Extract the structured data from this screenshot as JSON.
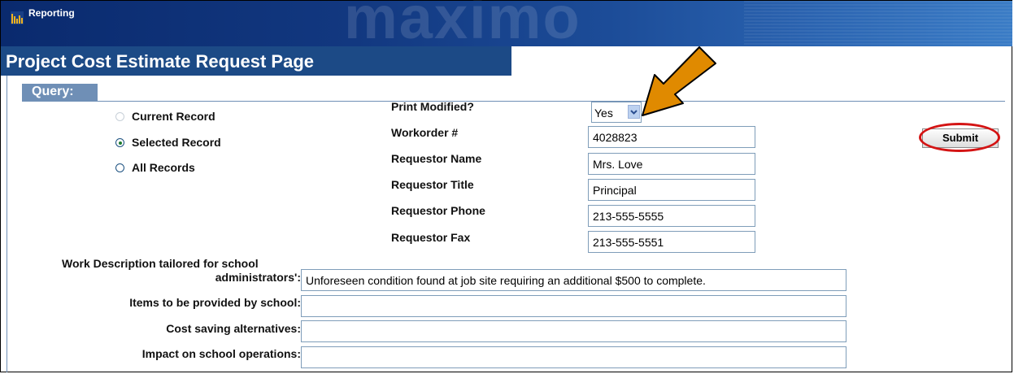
{
  "app": {
    "name": "Reporting",
    "brand": "maximo"
  },
  "page": {
    "title": "Project Cost Estimate Request Page"
  },
  "query": {
    "label": "Query:"
  },
  "scope": {
    "options": [
      {
        "label": "Current Record",
        "state": "disabled"
      },
      {
        "label": "Selected Record",
        "state": "checked"
      },
      {
        "label": "All Records",
        "state": "unchecked"
      }
    ]
  },
  "fields": {
    "print_modified": {
      "label": "Print Modified?",
      "value": "Yes"
    },
    "workorder": {
      "label": "Workorder #",
      "value": "4028823"
    },
    "requestor_name": {
      "label": "Requestor Name",
      "value": "Mrs. Love"
    },
    "requestor_title": {
      "label": "Requestor Title",
      "value": "Principal"
    },
    "requestor_phone": {
      "label": "Requestor Phone",
      "value": "213-555-5555"
    },
    "requestor_fax": {
      "label": "Requestor Fax",
      "value": "213-555-5551"
    }
  },
  "descriptions": {
    "work_description": {
      "label_line1": "Work Description tailored for school",
      "label_line2": "administrators':",
      "value": "Unforeseen condition found at job site requiring an additional $500 to complete."
    },
    "items_provided": {
      "label": "Items to be provided by school:",
      "value": ""
    },
    "cost_saving": {
      "label": "Cost saving alternatives:",
      "value": ""
    },
    "impact": {
      "label": "Impact on school operations:",
      "value": ""
    }
  },
  "actions": {
    "submit_label": "Submit"
  },
  "annotations": {
    "arrow_color": "#e08a00",
    "ring_color": "#d41414"
  }
}
